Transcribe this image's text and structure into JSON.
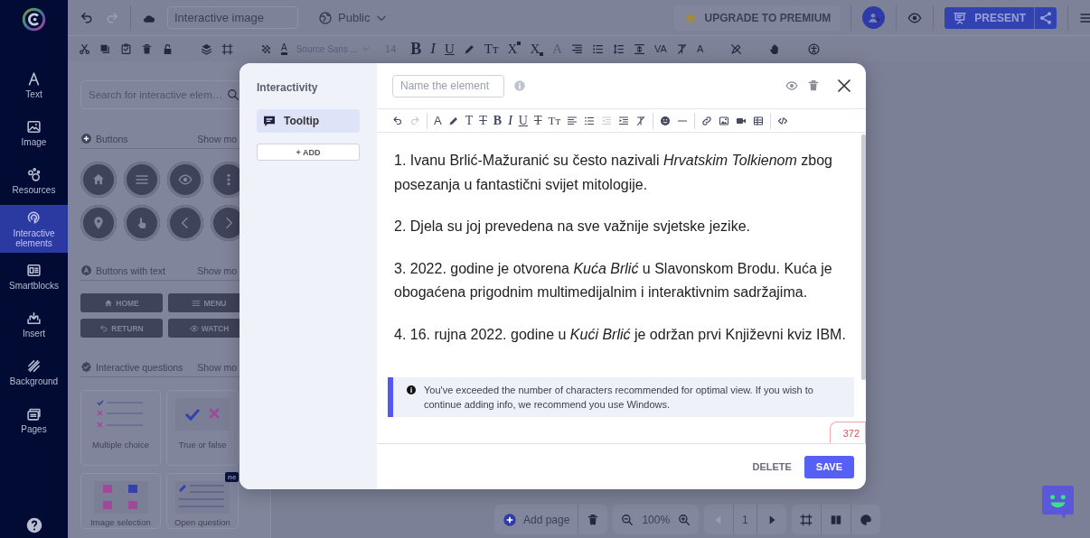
{
  "nav": {
    "items": [
      {
        "label": "Text",
        "selected": false
      },
      {
        "label": "Image",
        "selected": false
      },
      {
        "label": "Resources",
        "selected": false
      },
      {
        "label": "Interactive elements",
        "selected": true
      },
      {
        "label": "Smartblocks",
        "selected": false
      },
      {
        "label": "Insert",
        "selected": false
      },
      {
        "label": "Background",
        "selected": false
      },
      {
        "label": "Pages",
        "selected": false
      }
    ]
  },
  "topbar": {
    "project_title": "Interactive image",
    "visibility": "Public",
    "upgrade": "UPGRADE TO PREMIUM",
    "present": "PRESENT"
  },
  "format_toolbar": {
    "font": "Source Sans ...",
    "size": "14",
    "glyphs": [
      {
        "text": "A",
        "kind": "color",
        "disabled": false
      },
      {
        "text": "B",
        "kind": "bold",
        "disabled": false
      },
      {
        "text": "I",
        "kind": "italic",
        "disabled": false
      },
      {
        "text": "U",
        "kind": "underline",
        "disabled": false
      },
      {
        "text": "Tт",
        "kind": "case",
        "disabled": false
      },
      {
        "text": "X",
        "kind": "sup",
        "disabled": false
      },
      {
        "text": "X",
        "kind": "sub",
        "disabled": false
      },
      {
        "text": "A",
        "kind": "shadow",
        "disabled": true
      },
      {
        "text": "VA",
        "kind": "spacing",
        "disabled": false
      },
      {
        "text": "A",
        "kind": "spell",
        "disabled": false
      }
    ]
  },
  "panel": {
    "search_placeholder": "Search for interactive elem…",
    "sections": [
      {
        "title": "Buttons",
        "more": "Show mo"
      },
      {
        "title": "Buttons with text",
        "more": "Show mo"
      },
      {
        "title": "Interactive questions",
        "more": "Show mo"
      }
    ],
    "text_buttons": [
      "HOME",
      "MENU",
      "RETURN",
      "WATCH"
    ],
    "cards": [
      {
        "label": "Multiple choice"
      },
      {
        "label": "True or false"
      },
      {
        "label": "Image selection"
      },
      {
        "label": "Open question"
      }
    ],
    "new_badge": "ne"
  },
  "dialog": {
    "sidebar_title": "Interactivity",
    "tabs": [
      {
        "label": "Tooltip",
        "selected": true
      }
    ],
    "add_label": "+ ADD",
    "name_placeholder": "Name the element",
    "editor_glyphs": [
      {
        "text": "A",
        "kind": "color"
      },
      {
        "text": "T",
        "kind": "font"
      },
      {
        "text": "T",
        "kind": "strike"
      },
      {
        "text": "B",
        "kind": "bold"
      },
      {
        "text": "I",
        "kind": "italic"
      },
      {
        "text": "U",
        "kind": "underline"
      },
      {
        "text": "T",
        "kind": "strike"
      },
      {
        "text": "Tт",
        "kind": "case"
      }
    ],
    "paragraphs": [
      "1. Ivanu Brlić-Mažuranić su često nazivali *Hrvatskim Tolkienom* zbog posezanja u fantastični svijet mitologije.",
      "2. Djela su joj prevedena na sve važnije svjetske jezike.",
      "3. 2022. godine je otvorena *Kuća Brlić* u Slavonskom Brodu. Kuća je obogaćena prigodnim multimedijalnim i interaktivnim sadržajima.",
      "4. 16. rujna 2022. godine u *Kući Brlić* je održan prvi Književni kviz IBM."
    ],
    "notice": "You've exceeded the number of characters recommended for optimal view. If you wish to continue adding info, we recommend you use Windows.",
    "char_count": "372",
    "delete_label": "DELETE",
    "save_label": "SAVE"
  },
  "canvas_controls": {
    "add_page": "Add page",
    "zoom": "100%",
    "page": "1"
  }
}
